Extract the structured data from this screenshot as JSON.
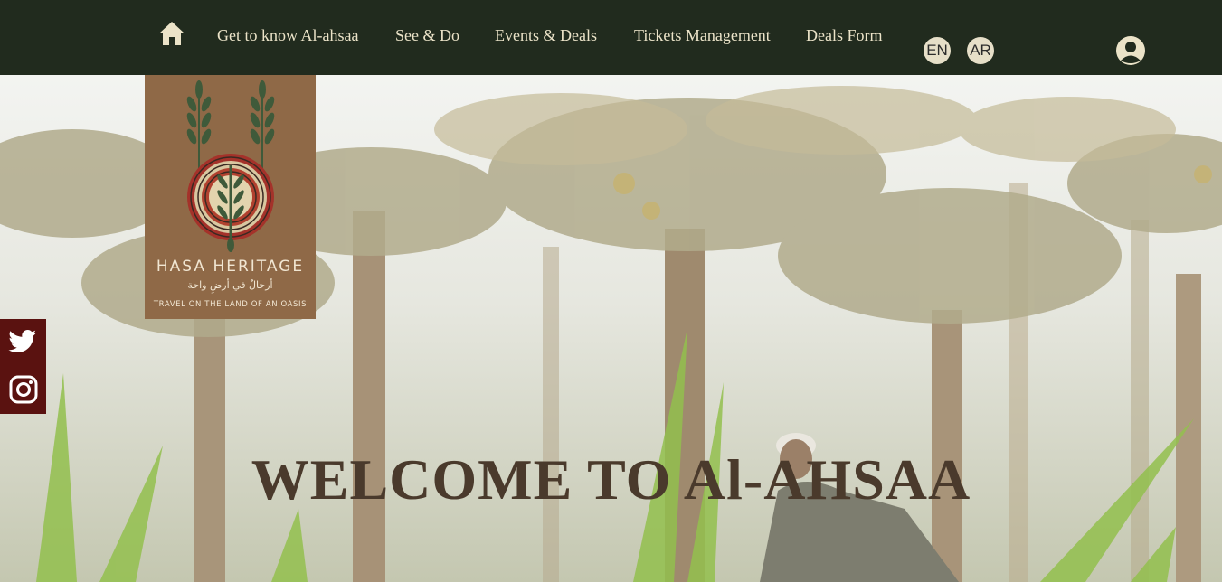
{
  "nav": {
    "home_icon": "home-icon",
    "items": [
      {
        "label": "Get to know Al-ahsaa"
      },
      {
        "label": "See & Do"
      },
      {
        "label": "Events & Deals"
      },
      {
        "label": "Tickets Management"
      },
      {
        "label": "Deals Form"
      }
    ],
    "languages": [
      "EN",
      "AR"
    ],
    "account_icon": "user-account-icon"
  },
  "logo": {
    "title": "HASA HERITAGE",
    "arabic": "أرحالٌ في أرضِ واحة",
    "tagline": "TRAVEL ON THE LAND OF AN OASIS"
  },
  "social": {
    "icons": [
      "twitter-icon",
      "instagram-icon"
    ]
  },
  "hero": {
    "headline": "WELCOME TO Al-AHSAA"
  },
  "colors": {
    "navbar": "#212b1e",
    "nav_text": "#ebe3c8",
    "logo_bg": "#8f6947",
    "social_bg": "#5a1210",
    "headline": "#4a3a2c"
  }
}
